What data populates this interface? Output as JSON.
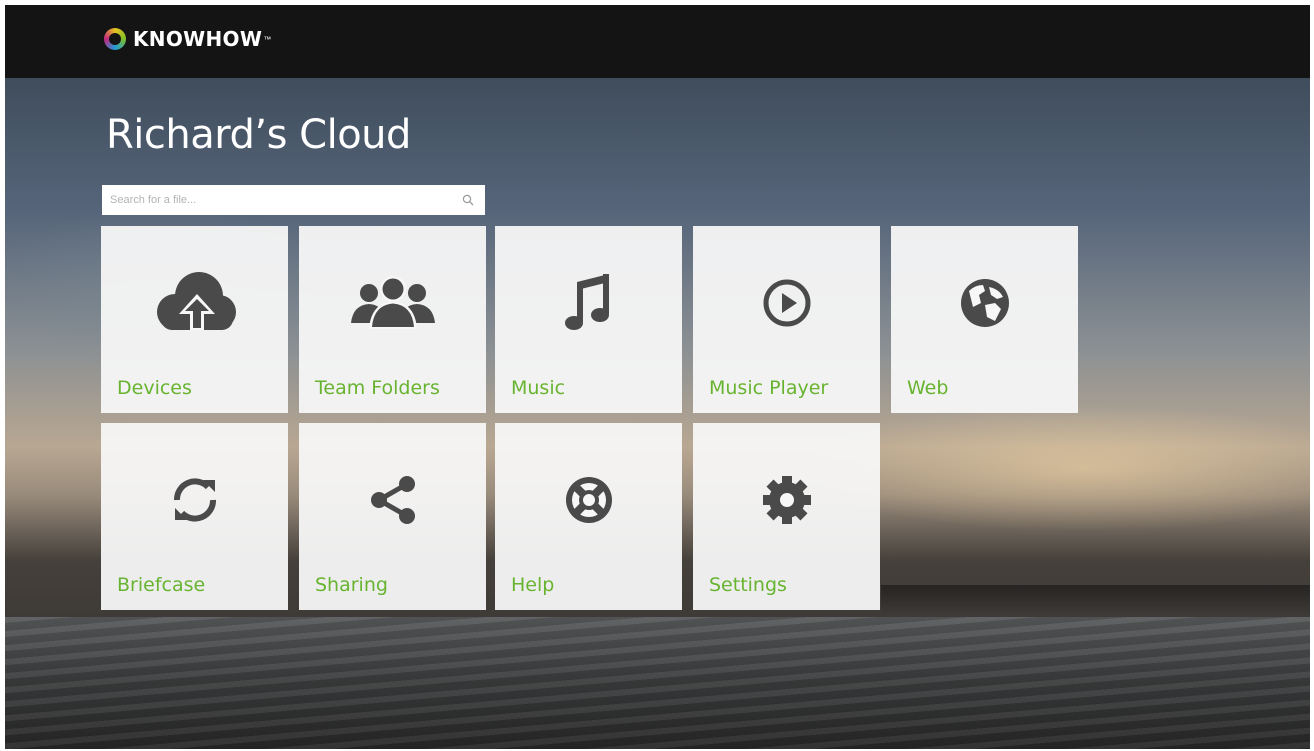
{
  "brand": {
    "name": "KNOWHOW",
    "tm": "™"
  },
  "page": {
    "title": "Richard’s Cloud"
  },
  "search": {
    "placeholder": "Search for a file..."
  },
  "tiles": [
    {
      "label": "Devices",
      "icon": "cloud-upload-icon"
    },
    {
      "label": "Team Folders",
      "icon": "group-icon"
    },
    {
      "label": "Music",
      "icon": "music-note-icon"
    },
    {
      "label": "Music Player",
      "icon": "play-circle-icon"
    },
    {
      "label": "Web",
      "icon": "globe-icon"
    },
    {
      "label": "Briefcase",
      "icon": "sync-icon"
    },
    {
      "label": "Sharing",
      "icon": "share-icon"
    },
    {
      "label": "Help",
      "icon": "lifebuoy-icon"
    },
    {
      "label": "Settings",
      "icon": "gear-icon"
    }
  ],
  "colors": {
    "accent": "#68b430",
    "icon": "#4a4a4a",
    "topbar": "#141414"
  }
}
